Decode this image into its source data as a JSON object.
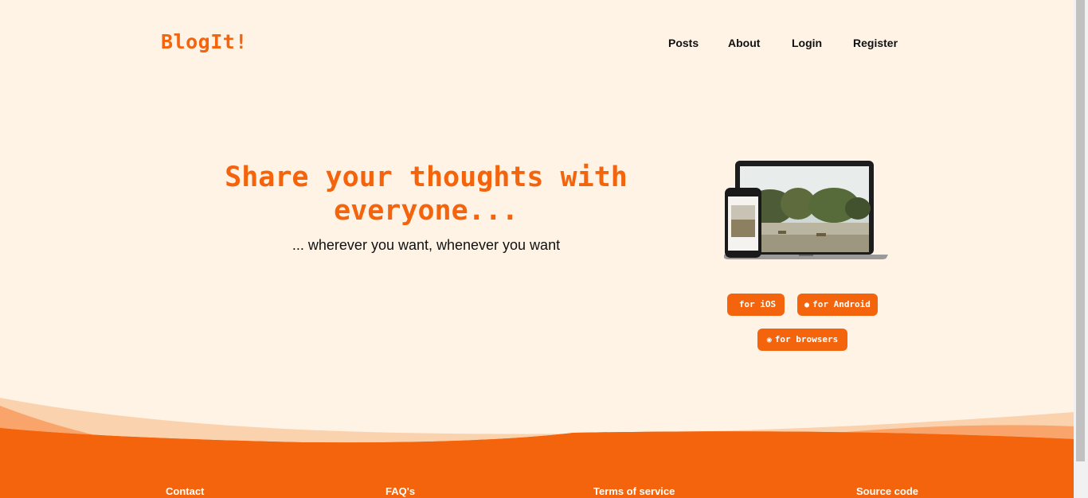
{
  "brand": {
    "logo": "BlogIt!",
    "accent_color": "#f4640c",
    "background_color": "#fff3e6"
  },
  "nav": {
    "items": [
      {
        "label": "Posts"
      },
      {
        "label": "About"
      },
      {
        "label": "Login"
      },
      {
        "label": "Register"
      }
    ]
  },
  "hero": {
    "title": "Share your thoughts with everyone...",
    "subtitle": "... wherever you want, whenever you want",
    "image_icon": "laptop-and-phone-mockup"
  },
  "downloads": {
    "ios": {
      "label": "for iOS",
      "icon": "apple-icon"
    },
    "android": {
      "label": "for Android",
      "icon": "android-icon"
    },
    "browsers": {
      "label": "for browsers",
      "icon": "chrome-icon"
    }
  },
  "footer": {
    "links": [
      {
        "label": "Contact"
      },
      {
        "label": "FAQ's"
      },
      {
        "label": "Terms of service"
      },
      {
        "label": "Source code"
      }
    ]
  }
}
